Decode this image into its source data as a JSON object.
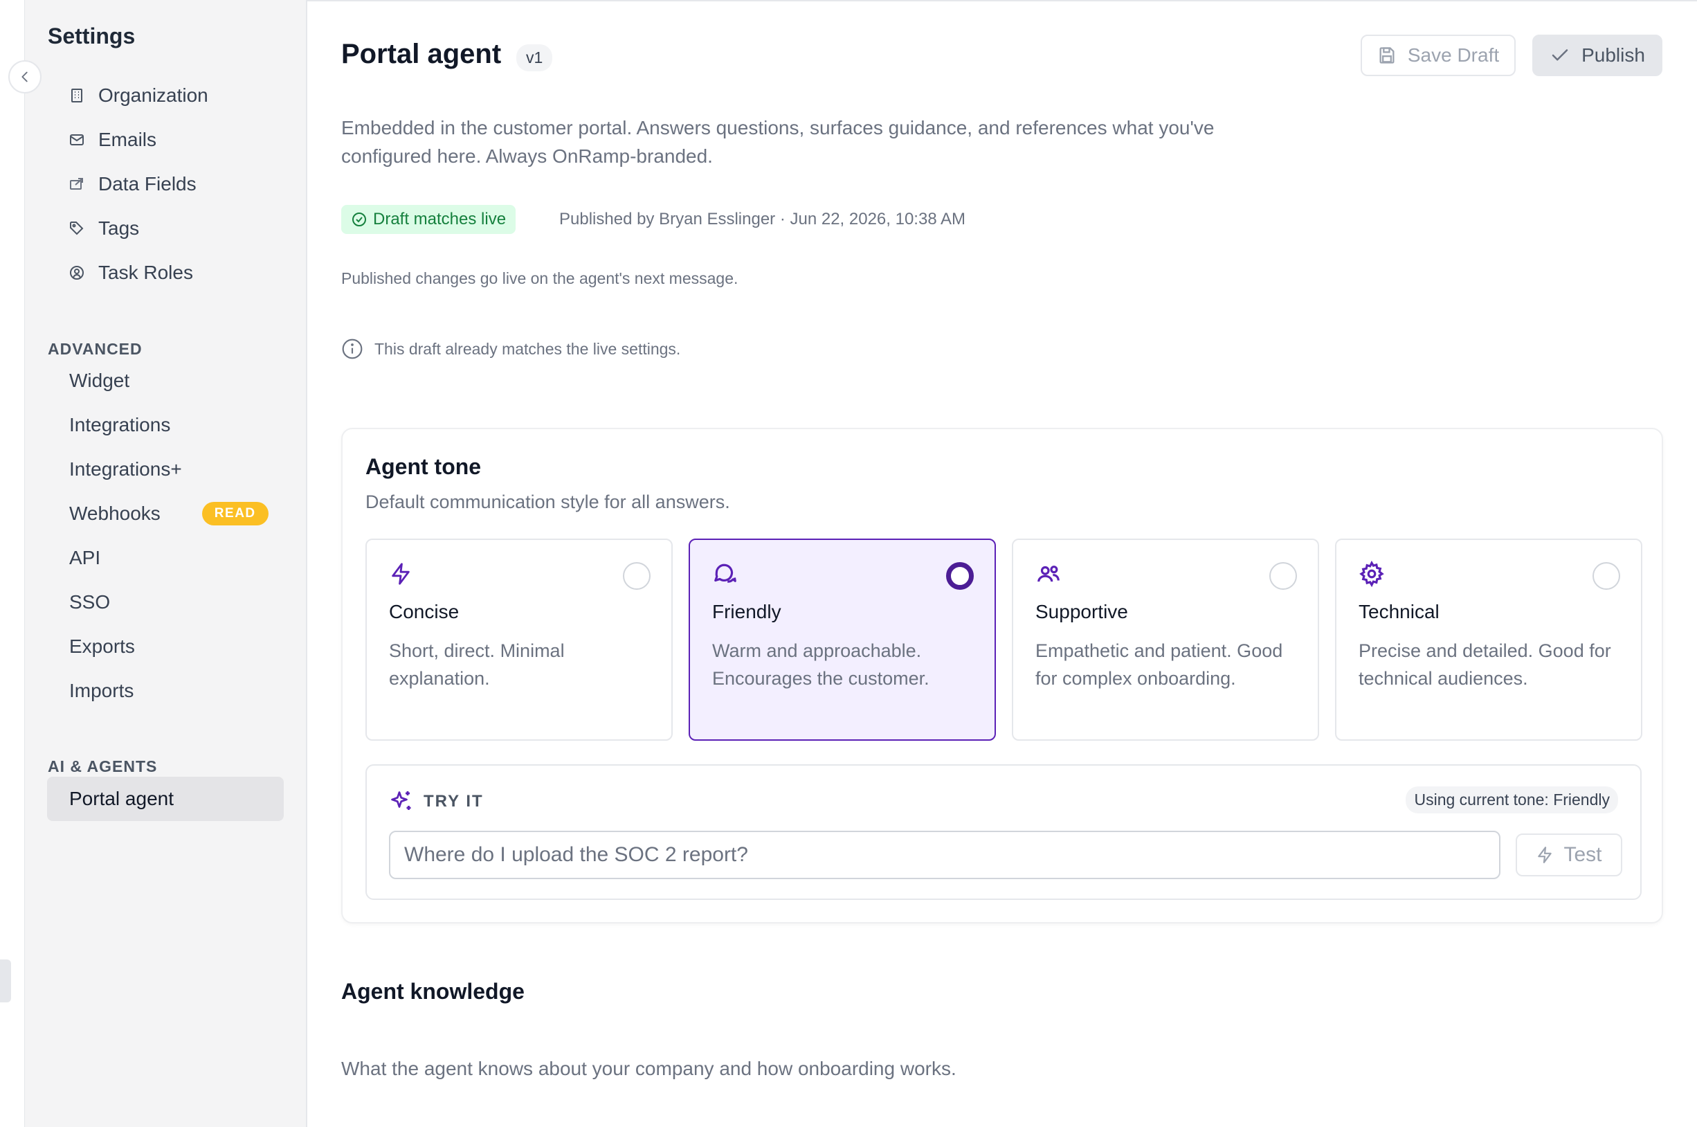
{
  "sidebar": {
    "title": "Settings",
    "items": [
      {
        "label": "Organization",
        "icon": "building-icon"
      },
      {
        "label": "Emails",
        "icon": "mail-icon"
      },
      {
        "label": "Data Fields",
        "icon": "data-fields-icon"
      },
      {
        "label": "Tags",
        "icon": "tag-icon"
      },
      {
        "label": "Task Roles",
        "icon": "task-roles-icon"
      }
    ],
    "advanced_heading": "ADVANCED",
    "advanced_items": [
      {
        "label": "Widget"
      },
      {
        "label": "Integrations"
      },
      {
        "label": "Integrations+"
      },
      {
        "label": "Webhooks",
        "badge": "READ"
      },
      {
        "label": "API"
      },
      {
        "label": "SSO"
      },
      {
        "label": "Exports"
      },
      {
        "label": "Imports"
      }
    ],
    "ai_heading": "AI & AGENTS",
    "ai_items": [
      {
        "label": "Portal agent",
        "active": true
      }
    ]
  },
  "header": {
    "title": "Portal agent",
    "version": "v1",
    "save_label": "Save Draft",
    "publish_label": "Publish"
  },
  "description": "Embedded in the customer portal. Answers questions, surfaces guidance, and references what you've configured here. Always OnRamp-branded.",
  "status": {
    "badge": "Draft matches live",
    "published_by": "Published by Bryan Esslinger · Jun 22, 2026, 10:38 AM",
    "golive_note": "Published changes go live on the agent's next message.",
    "info": "This draft already matches the live settings."
  },
  "tone": {
    "title": "Agent tone",
    "subtitle": "Default communication style for all answers.",
    "options": [
      {
        "name": "Concise",
        "desc": "Short, direct. Minimal explanation.",
        "icon": "lightning-icon",
        "selected": false
      },
      {
        "name": "Friendly",
        "desc": "Warm and approachable. Encourages the customer.",
        "icon": "chat-bubbles-icon",
        "selected": true
      },
      {
        "name": "Supportive",
        "desc": "Empathetic and patient. Good for complex onboarding.",
        "icon": "people-icon",
        "selected": false
      },
      {
        "name": "Technical",
        "desc": "Precise and detailed. Good for technical audiences.",
        "icon": "gear-icon",
        "selected": false
      }
    ]
  },
  "tryit": {
    "label": "TRY IT",
    "using": "Using current tone: Friendly",
    "placeholder": "Where do I upload the SOC 2 report?",
    "test_label": "Test"
  },
  "knowledge": {
    "title": "Agent knowledge",
    "subtitle": "What the agent knows about your company and how onboarding works."
  },
  "colors": {
    "accent": "#5b21b6",
    "selected_bg": "#f3efff",
    "status_green_bg": "#dcfce7",
    "status_green_text": "#15803d",
    "read_badge": "#fbbf24"
  }
}
